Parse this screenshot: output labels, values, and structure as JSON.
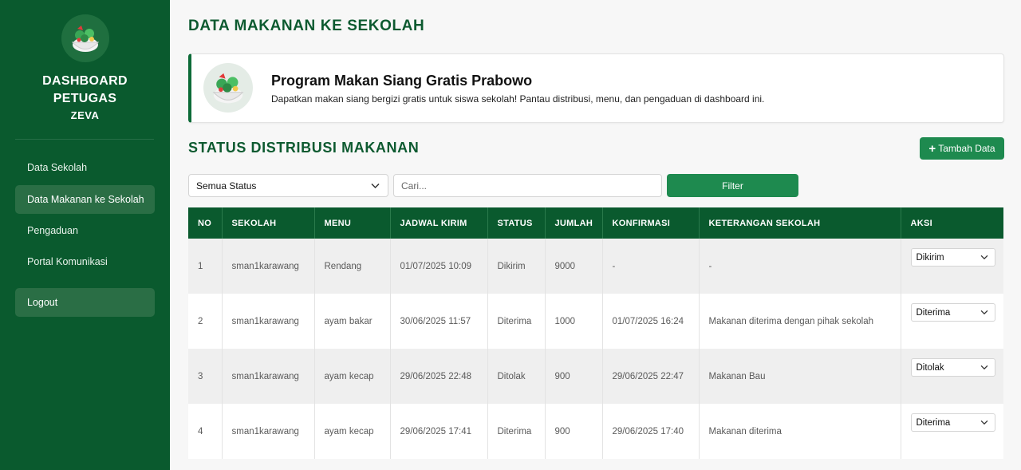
{
  "sidebar": {
    "brand_title_line1": "DASHBOARD",
    "brand_title_line2": "PETUGAS",
    "brand_sub": "ZEVA",
    "items": [
      {
        "label": "Data Sekolah",
        "active": false
      },
      {
        "label": "Data Makanan ke Sekolah",
        "active": true
      },
      {
        "label": "Pengaduan",
        "active": false
      },
      {
        "label": "Portal Komunikasi",
        "active": false
      }
    ],
    "logout_label": "Logout"
  },
  "page": {
    "title": "DATA MAKANAN KE SEKOLAH"
  },
  "banner": {
    "title": "Program Makan Siang Gratis Prabowo",
    "description": "Dapatkan makan siang bergizi gratis untuk siswa sekolah! Pantau distribusi, menu, dan pengaduan di dashboard ini."
  },
  "section": {
    "title": "STATUS DISTRIBUSI MAKANAN",
    "add_button_label": "Tambah Data"
  },
  "filters": {
    "status_selected": "Semua Status",
    "search_placeholder": "Cari...",
    "filter_button_label": "Filter"
  },
  "table": {
    "headers": [
      "NO",
      "SEKOLAH",
      "MENU",
      "JADWAL KIRIM",
      "STATUS",
      "JUMLAH",
      "KONFIRMASI",
      "KETERANGAN SEKOLAH",
      "AKSI"
    ],
    "rows": [
      {
        "no": "1",
        "sekolah": "sman1karawang",
        "menu": "Rendang",
        "jadwal": "01/07/2025 10:09",
        "status": "Dikirim",
        "jumlah": "9000",
        "konfirmasi": "-",
        "keterangan": "-",
        "aksi": "Dikirim"
      },
      {
        "no": "2",
        "sekolah": "sman1karawang",
        "menu": "ayam bakar",
        "jadwal": "30/06/2025 11:57",
        "status": "Diterima",
        "jumlah": "1000",
        "konfirmasi": "01/07/2025 16:24",
        "keterangan": "Makanan diterima dengan pihak sekolah",
        "aksi": "Diterima"
      },
      {
        "no": "3",
        "sekolah": "sman1karawang",
        "menu": "ayam kecap",
        "jadwal": "29/06/2025 22:48",
        "status": "Ditolak",
        "jumlah": "900",
        "konfirmasi": "29/06/2025 22:47",
        "keterangan": "Makanan Bau",
        "aksi": "Ditolak"
      },
      {
        "no": "4",
        "sekolah": "sman1karawang",
        "menu": "ayam kecap",
        "jadwal": "29/06/2025 17:41",
        "status": "Diterima",
        "jumlah": "900",
        "konfirmasi": "29/06/2025 17:40",
        "keterangan": "Makanan diterima",
        "aksi": "Diterima"
      }
    ]
  },
  "colors": {
    "sidebar_bg": "#0a5a2e",
    "accent": "#1e8a4f",
    "heading": "#0d5a30"
  }
}
